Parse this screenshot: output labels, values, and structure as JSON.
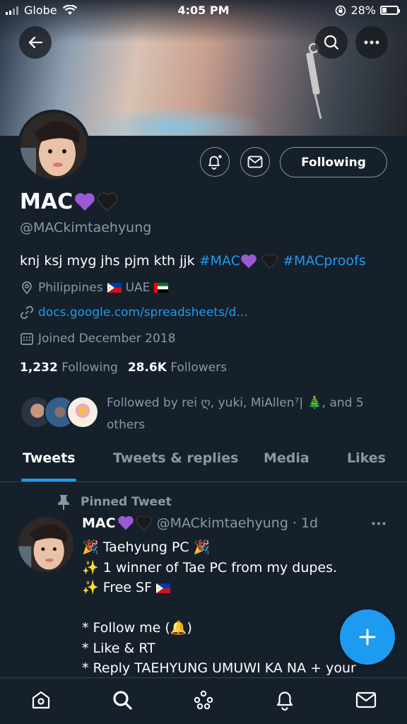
{
  "status_bar": {
    "carrier": "Globe",
    "time": "4:05 PM",
    "battery": "28%",
    "battery_level": 0.28
  },
  "profile": {
    "name": "MAC",
    "handle": "@MACkimtaehyung",
    "bio_text": "knj ksj myg jhs pjm kth jjk ",
    "bio_tag1": "#MAC",
    "bio_tag2": "#MACproofs",
    "location_1": "Philippines",
    "location_2": " UAE",
    "link": "docs.google.com/spreadsheets/d...",
    "joined": "Joined December 2018",
    "following_count": "1,232",
    "following_label": "Following",
    "followers_count": "28.6K",
    "followers_label": "Followers",
    "followed_by_line1": "Followed by rei ღ, yuki, MiAllen⁷| 🎄, and 5",
    "followed_by_line2": "others",
    "follow_button": "Following"
  },
  "tabs": [
    {
      "label": "Tweets",
      "active": true
    },
    {
      "label": "Tweets & replies",
      "active": false
    },
    {
      "label": "Media",
      "active": false
    },
    {
      "label": "Likes",
      "active": false
    }
  ],
  "tweet": {
    "pinned_label": "Pinned Tweet",
    "name": "MAC",
    "handle": "@MACkimtaehyung",
    "time": "· 1d",
    "lines": [
      "🎉 Taehyung PC 🎉",
      "✨ 1 winner of Tae PC from my dupes.",
      "✨ Free SF",
      "",
      "* Follow me (🔔)",
      "* Like & RT",
      "* Reply TAEHYUNG UMUWI KA NA + your"
    ]
  },
  "icons": {
    "back": "back-arrow-icon",
    "search": "search-icon",
    "more": "more-icon",
    "notifications": "bell-plus-icon",
    "message": "mail-icon",
    "location": "location-pin-icon",
    "link": "link-icon",
    "calendar": "calendar-icon",
    "pin": "pin-icon",
    "compose": "plus-icon",
    "nav": [
      "home-icon",
      "search-icon",
      "spaces-icon",
      "bell-icon",
      "mail-icon"
    ]
  },
  "colors": {
    "background": "#15202b",
    "accent": "#1d9bf0",
    "muted": "#8899a6",
    "divider": "#38444d"
  }
}
